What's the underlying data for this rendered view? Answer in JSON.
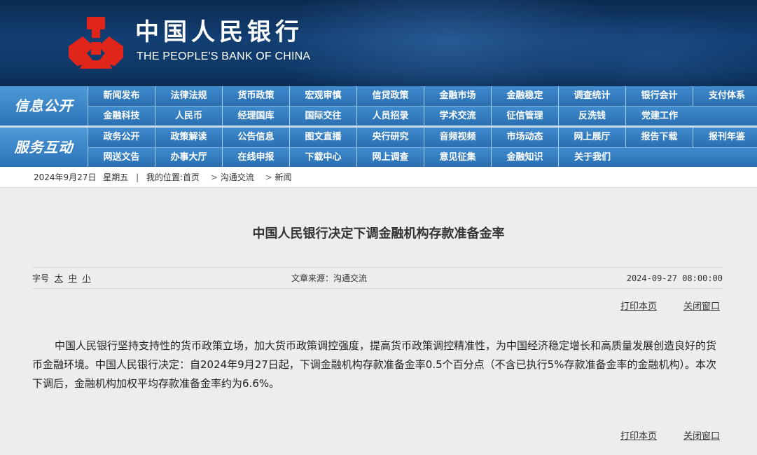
{
  "header": {
    "bank_name_cn": "中国人民银行",
    "bank_name_en": "THE PEOPLE'S BANK OF CHINA",
    "emblem_color": "#e0261b"
  },
  "nav": {
    "section1_label": "信息公开",
    "section1_row1": [
      "新闻发布",
      "法律法规",
      "货币政策",
      "宏观审慎",
      "信贷政策",
      "金融市场",
      "金融稳定",
      "调查统计",
      "银行会计",
      "支付体系"
    ],
    "section1_row2": [
      "金融科技",
      "人民币",
      "经理国库",
      "国际交往",
      "人员招录",
      "学术交流",
      "征信管理",
      "反洗钱",
      "党建工作"
    ],
    "section2_label": "服务互动",
    "section2_row1": [
      "政务公开",
      "政策解读",
      "公告信息",
      "图文直播",
      "央行研究",
      "音频视频",
      "市场动态",
      "网上展厅",
      "报告下载",
      "报刊年鉴"
    ],
    "section2_row2": [
      "网送文告",
      "办事大厅",
      "在线申报",
      "下载中心",
      "网上调查",
      "意见征集",
      "金融知识",
      "关于我们"
    ]
  },
  "breadcrumb": {
    "date": "2024年9月27日",
    "weekday": "星期五",
    "separator": "|",
    "location_label": "我的位置:",
    "home": "首页",
    "arrow": ">",
    "level1": "沟通交流",
    "level2": "新闻"
  },
  "article": {
    "title": "中国人民银行决定下调金融机构存款准备金率",
    "font_label": "字号",
    "font_large": "太",
    "font_medium": "中",
    "font_small": "小",
    "source": "文章来源：沟通交流",
    "datetime": "2024-09-27 08:00:00",
    "print_label": "打印本页",
    "close_label": "关闭窗口",
    "body": "中国人民银行坚持支持性的货币政策立场，加大货币政策调控强度，提高货币政策调控精准性，为中国经济稳定增长和高质量发展创造良好的货币金融环境。中国人民银行决定：自2024年9月27日起，下调金融机构存款准备金率0.5个百分点（不含已执行5%存款准备金率的金融机构）。本次下调后，金融机构加权平均存款准备金率约为6.6%。"
  }
}
